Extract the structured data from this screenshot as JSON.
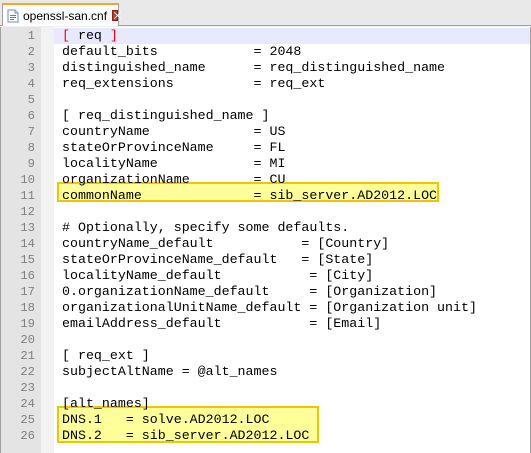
{
  "tab": {
    "filename": "openssl-san.cnf",
    "icon": "document-icon",
    "close_icon": "close-icon"
  },
  "editor": {
    "current_line": 1,
    "lines": [
      {
        "n": "1",
        "text": "[ req ]"
      },
      {
        "n": "2",
        "text": "default_bits            = 2048"
      },
      {
        "n": "3",
        "text": "distinguished_name      = req_distinguished_name"
      },
      {
        "n": "4",
        "text": "req_extensions          = req_ext"
      },
      {
        "n": "5",
        "text": ""
      },
      {
        "n": "6",
        "text": "[ req_distinguished_name ]"
      },
      {
        "n": "7",
        "text": "countryName             = US"
      },
      {
        "n": "8",
        "text": "stateOrProvinceName     = FL"
      },
      {
        "n": "9",
        "text": "localityName            = MI"
      },
      {
        "n": "10",
        "text": "organizationName        = CU"
      },
      {
        "n": "11",
        "text": "commonName              = sib_server.AD2012.LOC"
      },
      {
        "n": "12",
        "text": ""
      },
      {
        "n": "13",
        "text": "# Optionally, specify some defaults."
      },
      {
        "n": "14",
        "text": "countryName_default           = [Country]"
      },
      {
        "n": "15",
        "text": "stateOrProvinceName_default   = [State]"
      },
      {
        "n": "16",
        "text": "localityName_default           = [City]"
      },
      {
        "n": "17",
        "text": "0.organizationName_default     = [Organization]"
      },
      {
        "n": "18",
        "text": "organizationalUnitName_default = [Organization unit]"
      },
      {
        "n": "19",
        "text": "emailAddress_default           = [Email]"
      },
      {
        "n": "20",
        "text": ""
      },
      {
        "n": "21",
        "text": "[ req_ext ]"
      },
      {
        "n": "22",
        "text": "subjectAltName = @alt_names"
      },
      {
        "n": "23",
        "text": ""
      },
      {
        "n": "24",
        "text": "[alt_names]"
      },
      {
        "n": "25",
        "text": "DNS.1   = solve.AD2012.LOC"
      },
      {
        "n": "26",
        "text": "DNS.2   = sib_server.AD2012.LOC"
      }
    ],
    "colors": {
      "highlight_fill": "#ffff99",
      "highlight_border": "#f5c400",
      "current_line": "#e8e8ff",
      "bracket_red": "#ff0000"
    }
  }
}
